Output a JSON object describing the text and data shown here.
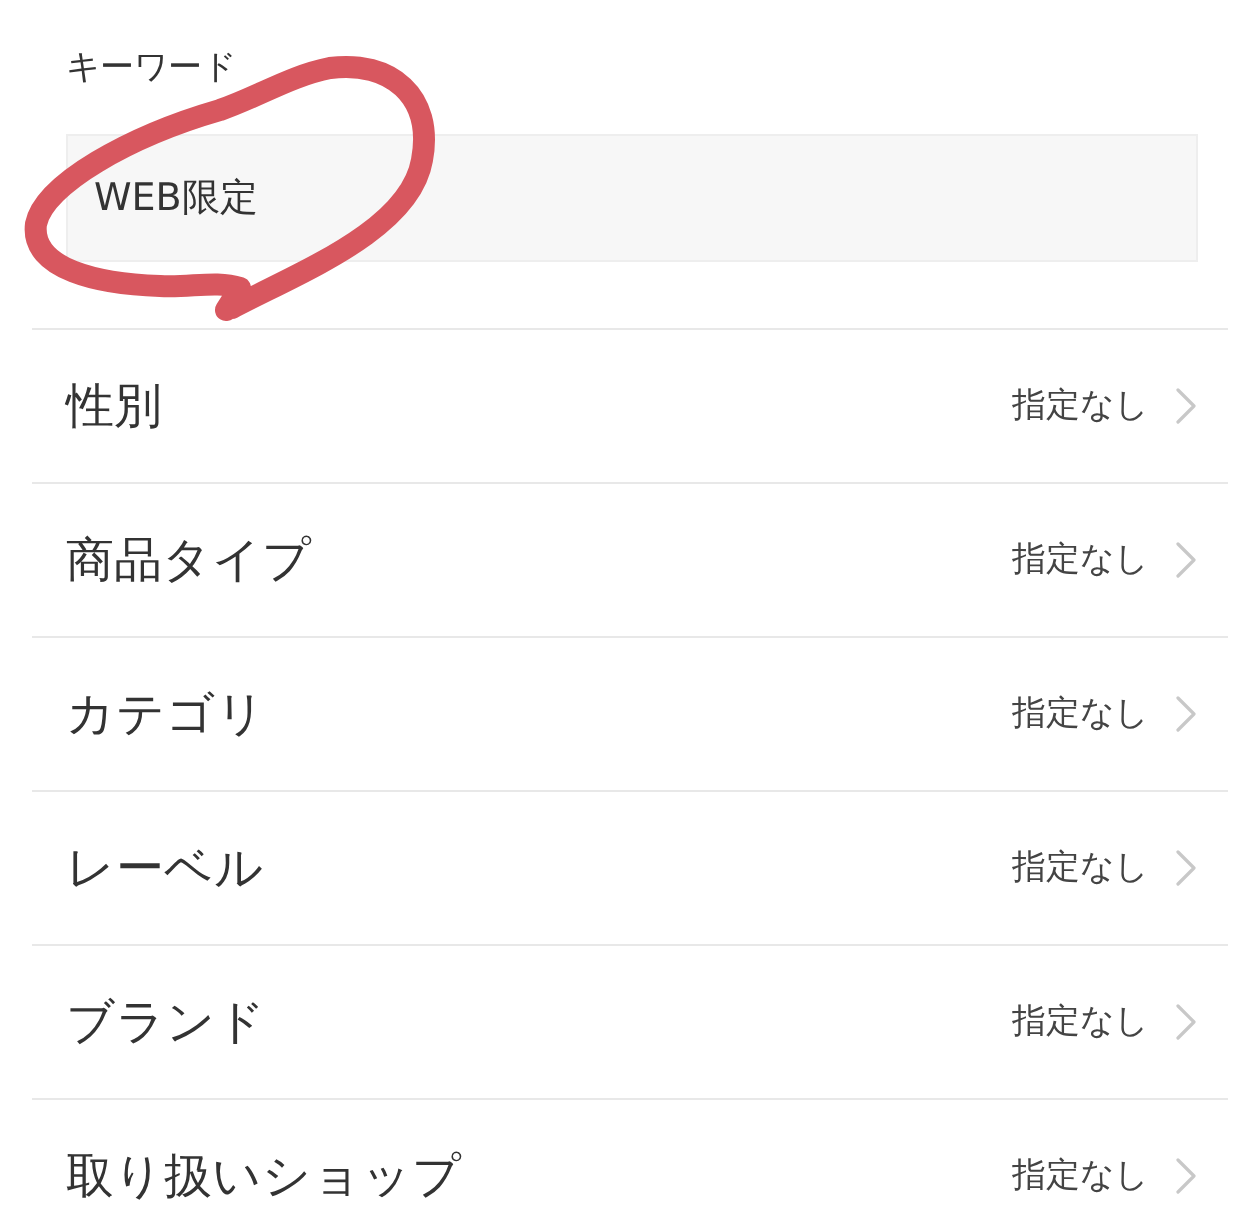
{
  "keyword": {
    "label": "キーワード",
    "value": "WEB限定"
  },
  "filters": [
    {
      "label": "性別",
      "value": "指定なし"
    },
    {
      "label": "商品タイプ",
      "value": "指定なし"
    },
    {
      "label": "カテゴリ",
      "value": "指定なし"
    },
    {
      "label": "レーベル",
      "value": "指定なし"
    },
    {
      "label": "ブランド",
      "value": "指定なし"
    },
    {
      "label": "取り扱いショップ",
      "value": "指定なし"
    }
  ]
}
